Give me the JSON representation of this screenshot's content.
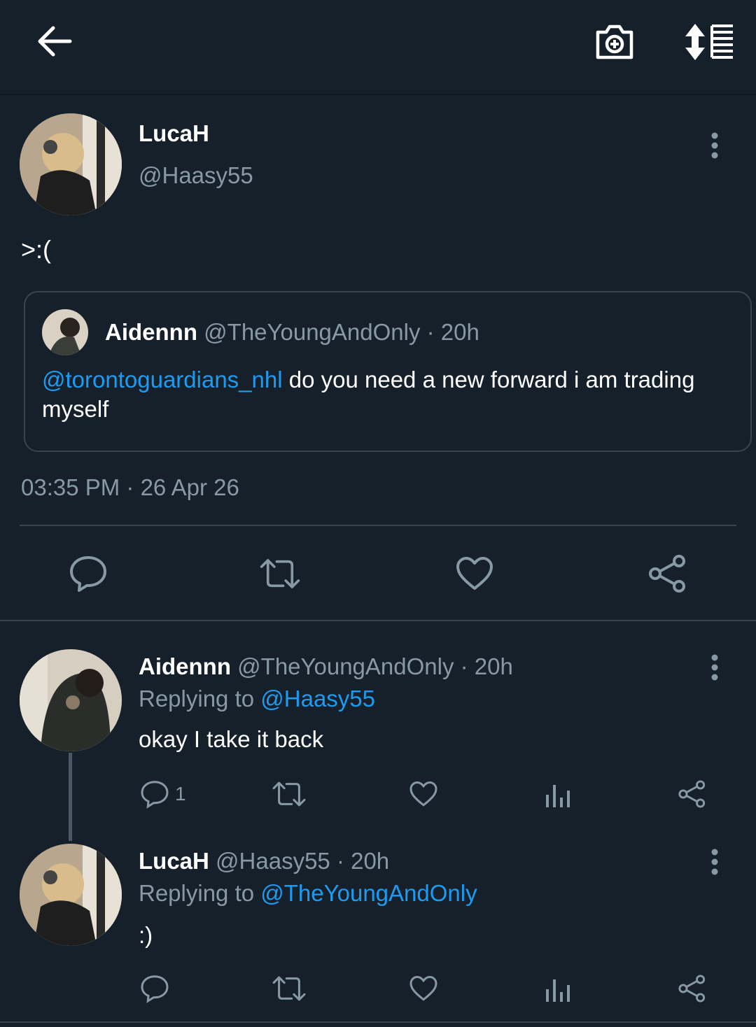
{
  "colors": {
    "background": "#16202b",
    "link": "#1d9bf0",
    "muted": "#8899a6",
    "border": "#38444d"
  },
  "header": {
    "icons": [
      "back-arrow-icon",
      "camera-add-icon",
      "sort-order-icon"
    ]
  },
  "tweet": {
    "name": "LucaH",
    "handle": "@Haasy55",
    "text": ">:(",
    "timestamp": "03:35 PM · 26 Apr 26",
    "quote": {
      "name": "Aidennn",
      "handle_time": "@TheYoungAndOnly · 20h",
      "mention": "@torontoguardians_nhl",
      "text": " do you need a new forward i am trading myself"
    },
    "actions": [
      "reply-icon",
      "retweet-icon",
      "like-icon",
      "share-icon"
    ]
  },
  "replies": [
    {
      "name": "Aidennn",
      "handle_time": "@TheYoungAndOnly · 20h",
      "replying_prefix": "Replying to ",
      "replying_to": "@Haasy55",
      "text": "okay I take it back",
      "reply_count": "1"
    },
    {
      "name": "LucaH",
      "handle_time": "@Haasy55 · 20h",
      "replying_prefix": "Replying to ",
      "replying_to": "@TheYoungAndOnly",
      "text": ":)",
      "reply_count": ""
    }
  ]
}
